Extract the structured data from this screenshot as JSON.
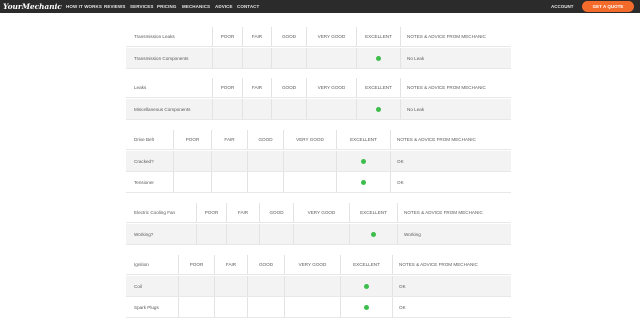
{
  "brand": {
    "logo_text": "YourMechanic"
  },
  "nav": {
    "links": [
      "HOW IT WORKS",
      "REVIEWS",
      "SERVICES",
      "PRICING",
      "MECHANICS",
      "ADVICE",
      "CONTACT"
    ],
    "account": "ACCOUNT",
    "cta": "GET A QUOTE",
    "cta_color": "#f26b2b"
  },
  "ghost_row": {
    "note": "No Leak"
  },
  "colors": {
    "excellent_dot": "#3dbd4c",
    "shade": "#f3f3f3"
  },
  "tables": [
    {
      "title": "Transmission Leaks",
      "ratings": [
        "POOR",
        "FAIR",
        "GOOD",
        "VERY GOOD",
        "EXCELLENT"
      ],
      "notes_header": "NOTES & ADVICE FROM MECHANIC",
      "rows": [
        {
          "item": "Transmission Components",
          "rating": "EXCELLENT",
          "note": "No Leak"
        }
      ]
    },
    {
      "title": "Leaks",
      "ratings": [
        "POOR",
        "FAIR",
        "GOOD",
        "VERY GOOD",
        "EXCELLENT"
      ],
      "notes_header": "NOTES & ADVICE FROM MECHANIC",
      "rows": [
        {
          "item": "Miscellaneous Components",
          "rating": "EXCELLENT",
          "note": "No Leak"
        }
      ]
    },
    {
      "title": "Drive Belt",
      "ratings": [
        "POOR",
        "FAIR",
        "GOOD",
        "VERY GOOD",
        "EXCELLENT"
      ],
      "notes_header": "NOTES & ADVICE FROM MECHANIC",
      "rows": [
        {
          "item": "Cracked?",
          "rating": "EXCELLENT",
          "note": "OK"
        },
        {
          "item": "Tensioner",
          "rating": "EXCELLENT",
          "note": "OK"
        }
      ]
    },
    {
      "title": "Electric Cooling Fan",
      "ratings": [
        "POOR",
        "FAIR",
        "GOOD",
        "VERY GOOD",
        "EXCELLENT"
      ],
      "notes_header": "NOTES & ADVICE FROM MECHANIC",
      "rows": [
        {
          "item": "Working?",
          "rating": "EXCELLENT",
          "note": "Working"
        }
      ]
    },
    {
      "title": "Ignition",
      "ratings": [
        "POOR",
        "FAIR",
        "GOOD",
        "VERY GOOD",
        "EXCELLENT"
      ],
      "notes_header": "NOTES & ADVICE FROM MECHANIC",
      "rows": [
        {
          "item": "Coil",
          "rating": "EXCELLENT",
          "note": "OK"
        },
        {
          "item": "Spark Plugs",
          "rating": "EXCELLENT",
          "note": "OK"
        }
      ]
    }
  ]
}
